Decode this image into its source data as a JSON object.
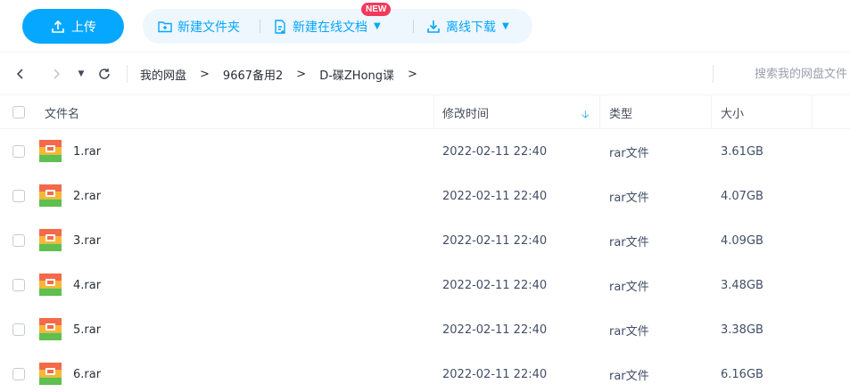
{
  "toolbar": {
    "upload_label": "上传",
    "new_folder_label": "新建文件夹",
    "new_online_doc_label": "新建在线文档",
    "new_badge": "NEW",
    "offline_download_label": "离线下载",
    "accent_color": "#06a7ff"
  },
  "nav": {
    "breadcrumb": [
      "我的网盘",
      "9667备用2",
      "D-碟ZHong谍"
    ],
    "breadcrumb_separator": ">",
    "search_placeholder": "搜索我的网盘文件"
  },
  "table": {
    "columns": {
      "name": "文件名",
      "modified": "修改时间",
      "type": "类型",
      "size": "大小"
    },
    "sort_column": "modified",
    "sort_direction": "desc",
    "rows": [
      {
        "name": "1.rar",
        "modified": "2022-02-11 22:40",
        "type": "rar文件",
        "size": "3.61GB",
        "icon": "rar-archive-icon"
      },
      {
        "name": "2.rar",
        "modified": "2022-02-11 22:40",
        "type": "rar文件",
        "size": "4.07GB",
        "icon": "rar-archive-icon"
      },
      {
        "name": "3.rar",
        "modified": "2022-02-11 22:40",
        "type": "rar文件",
        "size": "4.09GB",
        "icon": "rar-archive-icon"
      },
      {
        "name": "4.rar",
        "modified": "2022-02-11 22:40",
        "type": "rar文件",
        "size": "3.48GB",
        "icon": "rar-archive-icon"
      },
      {
        "name": "5.rar",
        "modified": "2022-02-11 22:40",
        "type": "rar文件",
        "size": "3.38GB",
        "icon": "rar-archive-icon"
      },
      {
        "name": "6.rar",
        "modified": "2022-02-11 22:40",
        "type": "rar文件",
        "size": "6.16GB",
        "icon": "rar-archive-icon"
      }
    ]
  }
}
